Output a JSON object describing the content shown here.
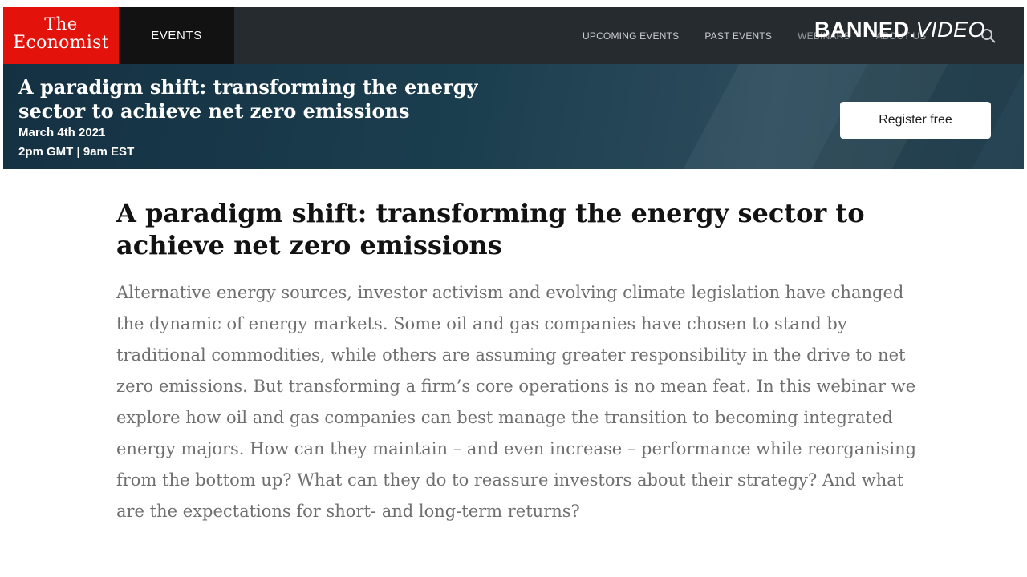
{
  "header": {
    "logo_line1": "The",
    "logo_line2": "Economist",
    "section_tab": "EVENTS",
    "nav": [
      "UPCOMING EVENTS",
      "PAST EVENTS",
      "WEBINARS",
      "ABOUT US"
    ],
    "search_icon": "search-icon"
  },
  "watermark": {
    "part1": "BANNED",
    "dot": ".",
    "part2": "VIDEO"
  },
  "banner": {
    "title": "A paradigm shift: transforming the energy sector to achieve net zero emissions",
    "date": "March 4th 2021",
    "time": "2pm GMT | 9am EST",
    "register_label": "Register free"
  },
  "main": {
    "title": "A paradigm shift: transforming the energy sector to achieve net zero emissions",
    "description": "Alternative energy sources, investor activism and evolving climate legislation have changed the dynamic of energy markets. Some oil and gas companies have chosen to stand by traditional commodities, while others are assuming greater responsibility in the drive to net zero emissions. But transforming a firm’s core operations is no mean feat. In this webinar we explore how oil and gas companies can best manage the transition to becoming integrated energy majors. How can they maintain – and even increase – performance while reorganising from the bottom up? What can they do to reassure investors about their strategy? And what are the expectations for short- and long-term returns?"
  },
  "colors": {
    "brand_red": "#e3120b",
    "nav_bg": "#262b30",
    "banner_bg": "#1b3e4f",
    "body_text": "#6f6f6f"
  }
}
